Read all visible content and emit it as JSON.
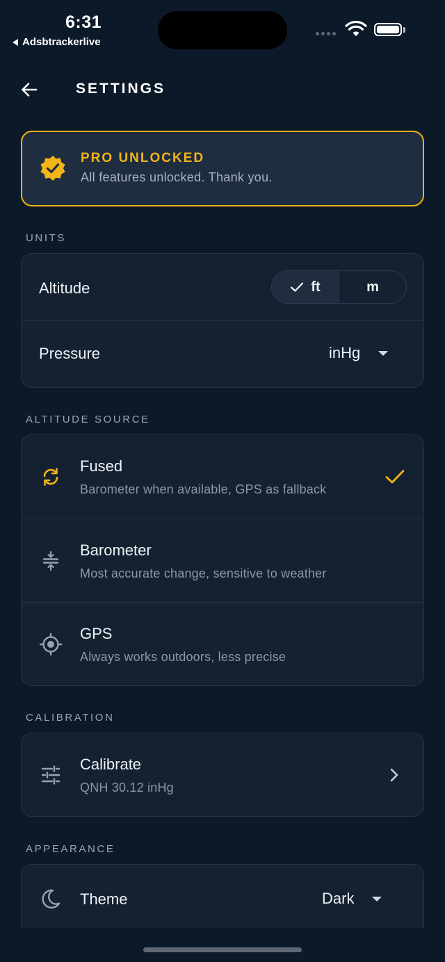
{
  "status": {
    "time": "6:31",
    "back_app": "Adsbtrackerlive"
  },
  "header": {
    "title": "SETTINGS"
  },
  "pro": {
    "title": "PRO UNLOCKED",
    "subtitle": "All features unlocked. Thank you."
  },
  "units": {
    "section_label": "UNITS",
    "altitude_label": "Altitude",
    "altitude_options": [
      "ft",
      "m"
    ],
    "altitude_selected": "ft",
    "pressure_label": "Pressure",
    "pressure_value": "inHg"
  },
  "altitude_source": {
    "section_label": "ALTITUDE SOURCE",
    "options": [
      {
        "title": "Fused",
        "subtitle": "Barometer when available, GPS as fallback",
        "icon": "sync-icon",
        "selected": true
      },
      {
        "title": "Barometer",
        "subtitle": "Most accurate change, sensitive to weather",
        "icon": "compress-icon",
        "selected": false
      },
      {
        "title": "GPS",
        "subtitle": "Always works outdoors, less precise",
        "icon": "gps-target-icon",
        "selected": false
      }
    ]
  },
  "calibration": {
    "section_label": "CALIBRATION",
    "title": "Calibrate",
    "subtitle": "QNH 30.12 inHg"
  },
  "appearance": {
    "section_label": "APPEARANCE",
    "theme_label": "Theme",
    "theme_value": "Dark"
  },
  "colors": {
    "accent": "#f2b417",
    "background": "#0c1929",
    "card": "#142131"
  }
}
